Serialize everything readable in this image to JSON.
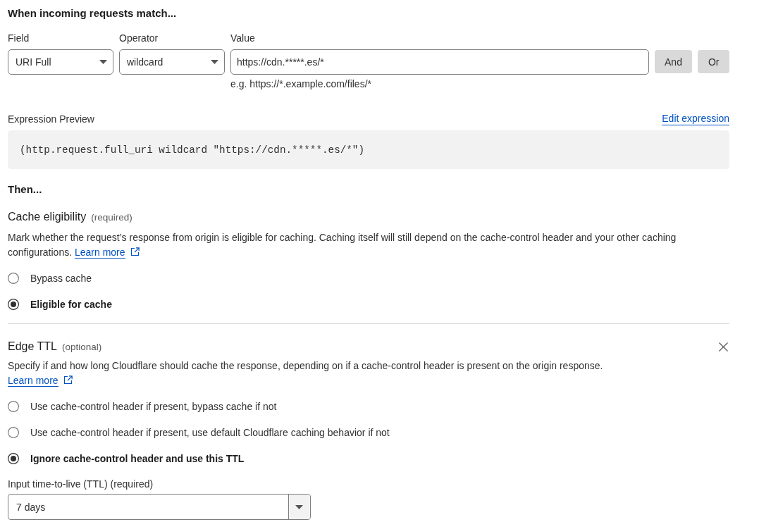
{
  "match_section": {
    "title": "When incoming requests match...",
    "fields": [
      {
        "kind": "select",
        "label": "Field",
        "value": "URI Full"
      },
      {
        "kind": "select",
        "label": "Operator",
        "value": "wildcard"
      },
      {
        "kind": "text",
        "label": "Value",
        "value": "https://cdn.*****.es/*",
        "hint": "e.g. https://*.example.com/files/*"
      }
    ],
    "buttons": [
      "And",
      "Or"
    ]
  },
  "expression_preview": {
    "label": "Expression Preview",
    "link": "Edit expression",
    "code": "(http.request.full_uri wildcard \"https://cdn.*****.es/*\")"
  },
  "then_title": "Then...",
  "settings": [
    {
      "kind": "inline",
      "title": "Cache eligibility",
      "qualifier": "(required)",
      "removable": false,
      "description": "Mark whether the request’s response from origin is eligible for caching. Caching itself will still depend on the cache-control header and your other caching configurations.",
      "link": "Learn more",
      "options": [
        {
          "label": "Bypass cache",
          "selected": false
        },
        {
          "label": "Eligible for cache",
          "selected": true
        }
      ]
    },
    {
      "kind": "stacked",
      "title": "Edge TTL",
      "qualifier": "(optional)",
      "removable": true,
      "description": "Specify if and how long Cloudflare should cache the response, depending on if a cache-control header is present on the origin response.",
      "link": "Learn more",
      "options": [
        {
          "label": "Use cache-control header if present, bypass cache if not",
          "selected": false
        },
        {
          "label": "Use cache-control header if present, use default Cloudflare caching behavior if not",
          "selected": false
        },
        {
          "label": "Ignore cache-control header and use this TTL",
          "selected": true
        }
      ],
      "ttl": {
        "label": "Input time-to-live (TTL) (required)",
        "value": "7 days"
      }
    }
  ]
}
